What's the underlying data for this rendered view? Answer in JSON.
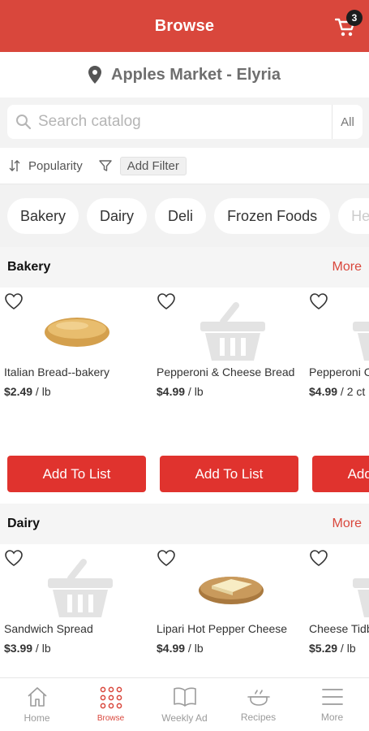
{
  "header": {
    "title": "Browse",
    "cart_count": "3"
  },
  "store": {
    "name": "Apples Market - Elyria"
  },
  "search": {
    "placeholder": "Search catalog",
    "scope": "All"
  },
  "filters": {
    "sort_label": "Popularity",
    "add_filter_label": "Add Filter"
  },
  "categories": [
    "Bakery",
    "Dairy",
    "Deli",
    "Frozen Foods",
    "Health"
  ],
  "sections": [
    {
      "title": "Bakery",
      "more_label": "More",
      "products": [
        {
          "name": "Italian Bread--bakery",
          "price": "$2.49",
          "unit": " / lb",
          "image": "bread",
          "button": "Add To List"
        },
        {
          "name": "Pepperoni & Cheese Bread",
          "price": "$4.99",
          "unit": " / lb",
          "image": "basket-placeholder",
          "button": "Add To List"
        },
        {
          "name": "Pepperoni Cheese",
          "price": "$4.99",
          "unit": " / 2 ct",
          "image": "basket-placeholder",
          "button": "Add To List"
        }
      ]
    },
    {
      "title": "Dairy",
      "more_label": "More",
      "products": [
        {
          "name": "Sandwich Spread",
          "price": "$3.99",
          "unit": " / lb",
          "image": "basket-placeholder"
        },
        {
          "name": "Lipari Hot Pepper Cheese",
          "price": "$4.99",
          "unit": " / lb",
          "image": "cheese-board"
        },
        {
          "name": "Cheese Tidbits",
          "price": "$5.29",
          "unit": " / lb",
          "image": "basket-placeholder"
        }
      ]
    }
  ],
  "bottom_nav": [
    {
      "label": "Home",
      "icon": "home-icon"
    },
    {
      "label": "Browse",
      "icon": "grid-dots-icon"
    },
    {
      "label": "Weekly Ad",
      "icon": "book-icon"
    },
    {
      "label": "Recipes",
      "icon": "cooking-pot-icon"
    },
    {
      "label": "More",
      "icon": "menu-icon"
    }
  ],
  "colors": {
    "brand": "#d9473c",
    "button": "#e0332e",
    "placeholder_icon": "#e3e3e3"
  }
}
